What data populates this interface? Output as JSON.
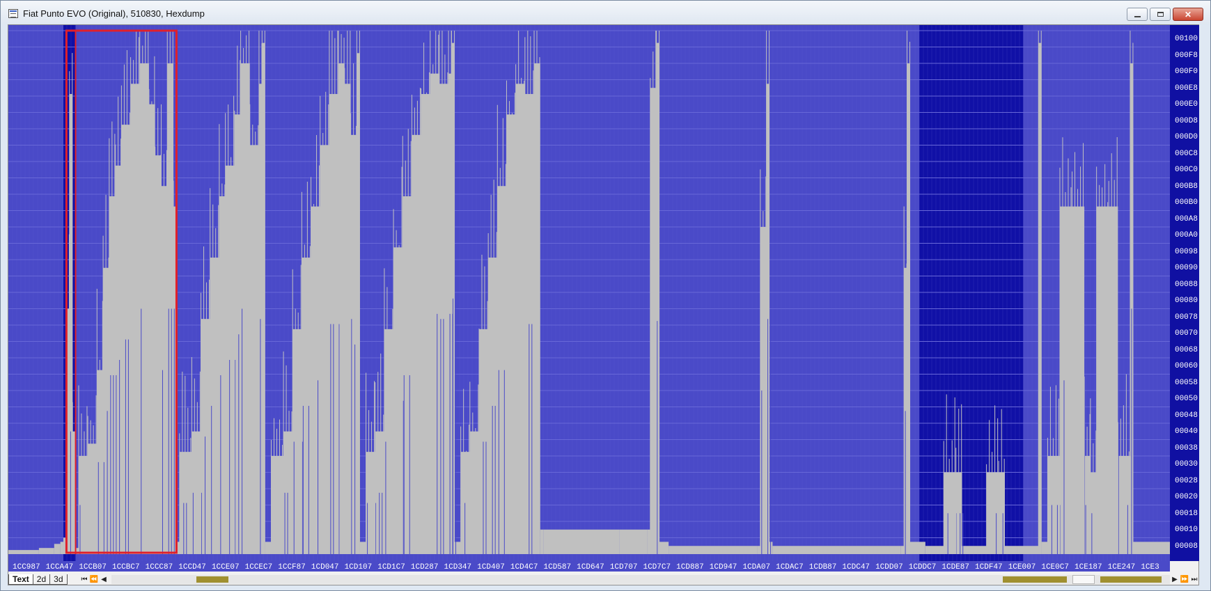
{
  "window": {
    "title": "Fiat Punto EVO (Original), 510830, Hexdump",
    "buttons": {
      "minimize": "minimize",
      "maximize": "maximize",
      "close": "✕"
    }
  },
  "view": {
    "tabs": [
      {
        "label": "Text",
        "active": true
      },
      {
        "label": "2d",
        "active": false
      },
      {
        "label": "3d",
        "active": false
      }
    ],
    "nav_left": [
      "⏮",
      "⏪",
      "◀"
    ],
    "nav_right": [
      "▶",
      "⏩",
      "⏭"
    ]
  },
  "colors": {
    "plot_bg": "#4a4ac8",
    "plot_bg_dark": "#1010a6",
    "bars": "#c0c0c0",
    "grid": "#6868d8",
    "selection": "#e0202a",
    "scroll_marker": "#a09030"
  },
  "chart_data": {
    "type": "area",
    "title": "",
    "ylim": [
      0,
      256
    ],
    "y_ticks": [
      "00100",
      "000F8",
      "000F0",
      "000E8",
      "000E0",
      "000D8",
      "000D0",
      "000C8",
      "000C0",
      "000B8",
      "000B0",
      "000A8",
      "000A0",
      "00098",
      "00090",
      "00088",
      "00080",
      "00078",
      "00070",
      "00068",
      "00060",
      "00058",
      "00050",
      "00048",
      "00040",
      "00038",
      "00030",
      "00028",
      "00020",
      "00018",
      "00010",
      "00008"
    ],
    "x_ticks": [
      "1CC987",
      "1CCA47",
      "1CCB07",
      "1CCBC7",
      "1CCC87",
      "1CCD47",
      "1CCE07",
      "1CCEC7",
      "1CCF87",
      "1CD047",
      "1CD107",
      "1CD1C7",
      "1CD287",
      "1CD347",
      "1CD407",
      "1CD4C7",
      "1CD587",
      "1CD647",
      "1CD707",
      "1CD7C7",
      "1CD887",
      "1CD947",
      "1CDA07",
      "1CDAC7",
      "1CDB87",
      "1CDC47",
      "1CDD07",
      "1CDDC7",
      "1CDE87",
      "1CDF47",
      "1CE007",
      "1CE0C7",
      "1CE187",
      "1CE247",
      "1CE3"
    ],
    "x_start": "1CC987",
    "x_end": "1CE3",
    "selection": {
      "from": "1CCA47",
      "to": "1CCC87"
    },
    "profile": [
      {
        "x": 0,
        "y": 2
      },
      {
        "x": 20,
        "y": 3
      },
      {
        "x": 30,
        "y": 5
      },
      {
        "x": 34,
        "y": 6
      },
      {
        "x": 36,
        "y": 8
      },
      {
        "x": 38,
        "y": 120
      },
      {
        "x": 40,
        "y": 225
      },
      {
        "x": 42,
        "y": 60
      },
      {
        "x": 44,
        "y": 3
      },
      {
        "x": 46,
        "y": 48
      },
      {
        "x": 52,
        "y": 54
      },
      {
        "x": 58,
        "y": 90
      },
      {
        "x": 62,
        "y": 140
      },
      {
        "x": 66,
        "y": 175
      },
      {
        "x": 70,
        "y": 190
      },
      {
        "x": 74,
        "y": 210
      },
      {
        "x": 80,
        "y": 230
      },
      {
        "x": 86,
        "y": 240
      },
      {
        "x": 92,
        "y": 220
      },
      {
        "x": 96,
        "y": 195
      },
      {
        "x": 100,
        "y": 180
      },
      {
        "x": 104,
        "y": 240
      },
      {
        "x": 108,
        "y": 170
      },
      {
        "x": 110,
        "y": 6
      },
      {
        "x": 112,
        "y": 50
      },
      {
        "x": 120,
        "y": 60
      },
      {
        "x": 126,
        "y": 115
      },
      {
        "x": 132,
        "y": 145
      },
      {
        "x": 138,
        "y": 175
      },
      {
        "x": 142,
        "y": 190
      },
      {
        "x": 148,
        "y": 215
      },
      {
        "x": 152,
        "y": 240
      },
      {
        "x": 158,
        "y": 200
      },
      {
        "x": 164,
        "y": 230
      },
      {
        "x": 166,
        "y": 250
      },
      {
        "x": 168,
        "y": 6
      },
      {
        "x": 172,
        "y": 48
      },
      {
        "x": 180,
        "y": 60
      },
      {
        "x": 186,
        "y": 110
      },
      {
        "x": 192,
        "y": 145
      },
      {
        "x": 198,
        "y": 170
      },
      {
        "x": 204,
        "y": 200
      },
      {
        "x": 210,
        "y": 225
      },
      {
        "x": 216,
        "y": 240
      },
      {
        "x": 220,
        "y": 230
      },
      {
        "x": 224,
        "y": 205
      },
      {
        "x": 228,
        "y": 245
      },
      {
        "x": 230,
        "y": 6
      },
      {
        "x": 234,
        "y": 50
      },
      {
        "x": 240,
        "y": 60
      },
      {
        "x": 246,
        "y": 110
      },
      {
        "x": 252,
        "y": 150
      },
      {
        "x": 258,
        "y": 175
      },
      {
        "x": 264,
        "y": 205
      },
      {
        "x": 270,
        "y": 225
      },
      {
        "x": 276,
        "y": 235
      },
      {
        "x": 282,
        "y": 230
      },
      {
        "x": 288,
        "y": 235
      },
      {
        "x": 290,
        "y": 250
      },
      {
        "x": 292,
        "y": 6
      },
      {
        "x": 296,
        "y": 50
      },
      {
        "x": 302,
        "y": 60
      },
      {
        "x": 308,
        "y": 110
      },
      {
        "x": 314,
        "y": 145
      },
      {
        "x": 320,
        "y": 180
      },
      {
        "x": 326,
        "y": 215
      },
      {
        "x": 332,
        "y": 230
      },
      {
        "x": 338,
        "y": 225
      },
      {
        "x": 344,
        "y": 240
      },
      {
        "x": 348,
        "y": 12
      },
      {
        "x": 350,
        "y": 12
      },
      {
        "x": 400,
        "y": 12
      },
      {
        "x": 418,
        "y": 12
      },
      {
        "x": 420,
        "y": 228
      },
      {
        "x": 424,
        "y": 250
      },
      {
        "x": 426,
        "y": 6
      },
      {
        "x": 432,
        "y": 4
      },
      {
        "x": 490,
        "y": 4
      },
      {
        "x": 492,
        "y": 160
      },
      {
        "x": 496,
        "y": 230
      },
      {
        "x": 498,
        "y": 6
      },
      {
        "x": 500,
        "y": 4
      },
      {
        "x": 584,
        "y": 4
      },
      {
        "x": 586,
        "y": 140
      },
      {
        "x": 588,
        "y": 240
      },
      {
        "x": 590,
        "y": 6
      },
      {
        "x": 600,
        "y": 4
      },
      {
        "x": 612,
        "y": 40
      },
      {
        "x": 620,
        "y": 40
      },
      {
        "x": 624,
        "y": 4
      },
      {
        "x": 640,
        "y": 40
      },
      {
        "x": 648,
        "y": 40
      },
      {
        "x": 652,
        "y": 4
      },
      {
        "x": 660,
        "y": 4
      },
      {
        "x": 674,
        "y": 250
      },
      {
        "x": 676,
        "y": 6
      },
      {
        "x": 680,
        "y": 48
      },
      {
        "x": 688,
        "y": 170
      },
      {
        "x": 696,
        "y": 170
      },
      {
        "x": 704,
        "y": 48
      },
      {
        "x": 708,
        "y": 40
      },
      {
        "x": 712,
        "y": 170
      },
      {
        "x": 720,
        "y": 170
      },
      {
        "x": 726,
        "y": 48
      },
      {
        "x": 734,
        "y": 240
      },
      {
        "x": 736,
        "y": 6
      },
      {
        "x": 760,
        "y": 6
      }
    ]
  }
}
